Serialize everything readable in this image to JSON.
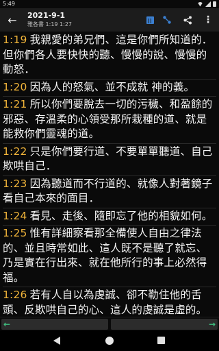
{
  "status_bar": {
    "time": "5:49"
  },
  "header": {
    "title": "2021-9-1",
    "subtitle": "雅各書 1:19 1:27",
    "icons": [
      "back-icon",
      "calendar-icon",
      "compare-icon",
      "share-icon",
      "more-icon"
    ],
    "more_label": "⋮"
  },
  "verses": [
    {
      "num": "1:19",
      "text": "我親愛的弟兄們、這是你們所知道的．但你們各人要快快的聽、慢慢的說、慢慢的動怒．"
    },
    {
      "num": "1:20",
      "text": "因為人的怒氣、並不成就 神的義。"
    },
    {
      "num": "1:21",
      "text": "所以你們要脫去一切的污穢、和盈餘的邪惡、存溫柔的心領受那所栽種的道、就是能救你們靈魂的道。"
    },
    {
      "num": "1:22",
      "text": "只是你們要行道、不要單單聽道、自己欺哄自己．"
    },
    {
      "num": "1:23",
      "text": "因為聽道而不行道的、就像人對著鏡子看自己本來的面目．"
    },
    {
      "num": "1:24",
      "text": "看見、走後、隨即忘了他的相貌如何。"
    },
    {
      "num": "1:25",
      "text": "惟有詳細察看那全備使人自由之律法的、並且時常如此、這人既不是聽了就忘、乃是實在行出來、就在他所行的事上必然得福。"
    },
    {
      "num": "1:26",
      "text": "若有人自以為虔誠、卻不勒住他的舌頭、反欺哄自己的心、這人的虔誠是虛的。"
    }
  ],
  "bottom_nav": {
    "prev_arrow": "←",
    "next_arrow": "→"
  },
  "colors": {
    "verse_number": "#f0b43a",
    "accent_blue": "#3b7fd0",
    "arrow_green": "#3fbf7f"
  }
}
